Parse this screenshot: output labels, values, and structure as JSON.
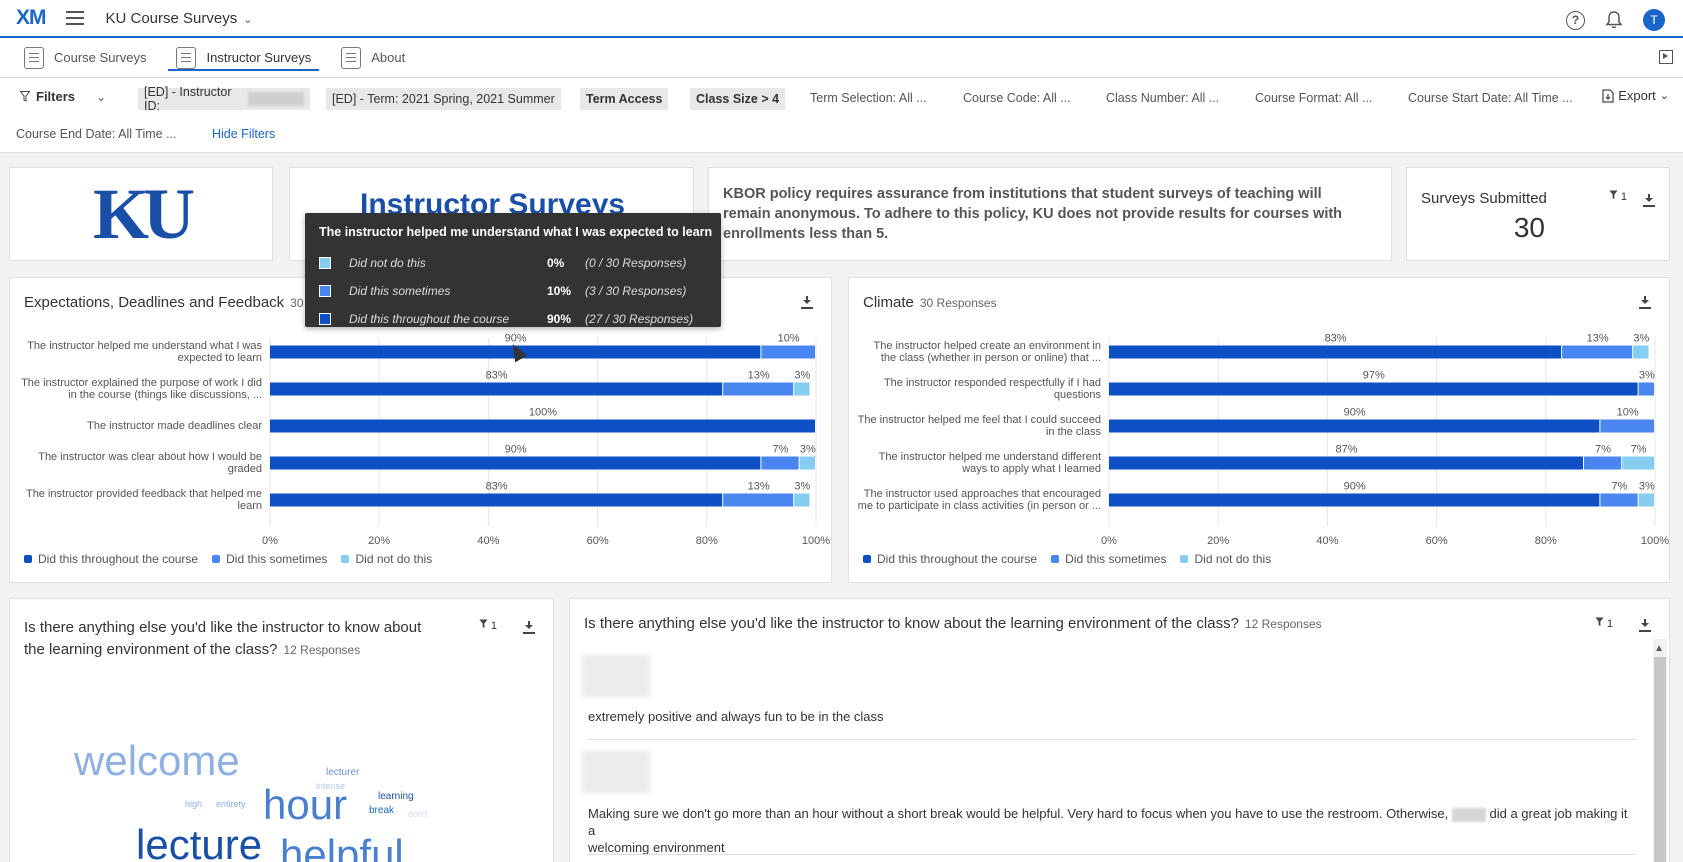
{
  "app": {
    "logo": "XM",
    "project_title": "KU Course Surveys",
    "help_label": "?",
    "avatar_initial": "T"
  },
  "tabs": [
    {
      "label": "Course Surveys"
    },
    {
      "label": "Instructor Surveys",
      "active": true
    },
    {
      "label": "About"
    }
  ],
  "filters": {
    "label": "Filters",
    "chips": {
      "instructor_id": "[ED] - Instructor ID:",
      "term": "[ED] - Term: 2021 Spring, 2021 Summer",
      "term_access": "Term Access",
      "class_size": "Class Size > 4"
    },
    "term_selection": "Term Selection:  All ...",
    "course_code": "Course Code:  All ...",
    "class_number": "Class Number:  All ...",
    "course_format": "Course Format:  All ...",
    "course_start": "Course Start Date: All Time ...",
    "course_end": "Course End Date: All Time ...",
    "hide_filters": "Hide Filters",
    "export": "Export"
  },
  "header_cards": {
    "logo_text": "KU",
    "instructor_title": "Instructor Surveys",
    "policy": "KBOR policy requires assurance from institutions that student surveys of teaching will remain anonymous. To adhere to this policy, KU does not provide results for courses with enrollments less than 5.",
    "surveys_submitted_label": "Surveys Submitted",
    "surveys_submitted_value": "30",
    "filter_count": "1"
  },
  "colors": {
    "throughout": "#0d4fc4",
    "sometimes": "#4a86f0",
    "not": "#85cef2"
  },
  "expectations": {
    "title": "Expectations, Deadlines and Feedback",
    "responses": "30 Responses",
    "legend": [
      "Did this throughout the course",
      "Did this sometimes",
      "Did not do this"
    ]
  },
  "climate": {
    "title": "Climate",
    "responses": "30 Responses",
    "legend": [
      "Did this throughout the course",
      "Did this sometimes",
      "Did not do this"
    ]
  },
  "chart_data": [
    {
      "type": "bar",
      "orientation": "horizontal-stacked",
      "title": "Expectations, Deadlines and Feedback",
      "categories": [
        "The instructor helped me understand what I was expected to learn",
        "The instructor explained the purpose of work I did in the course (things like discussions, ...",
        "The instructor made deadlines clear",
        "The instructor was clear about how I would be graded",
        "The instructor provided feedback that helped me learn"
      ],
      "category_lines": [
        [
          "The instructor helped me understand what I was",
          "expected to learn"
        ],
        [
          "The instructor explained the purpose of work I did",
          "in the course (things like discussions, ..."
        ],
        [
          "The instructor made deadlines clear"
        ],
        [
          "The instructor was clear about how I would be",
          "graded"
        ],
        [
          "The instructor provided feedback that helped me",
          "learn"
        ]
      ],
      "series": [
        {
          "name": "Did this throughout the course",
          "values": [
            90,
            83,
            100,
            90,
            83
          ]
        },
        {
          "name": "Did this sometimes",
          "values": [
            10,
            13,
            0,
            7,
            13
          ]
        },
        {
          "name": "Did not do this",
          "values": [
            0,
            3,
            0,
            3,
            3
          ]
        }
      ],
      "xlim": [
        0,
        100
      ],
      "x_ticks": [
        "0%",
        "20%",
        "40%",
        "60%",
        "80%",
        "100%"
      ],
      "legend_position": "bottom-left"
    },
    {
      "type": "bar",
      "orientation": "horizontal-stacked",
      "title": "Climate",
      "categories": [
        "The instructor helped create an environment in the class (whether in person or online) that ...",
        "The instructor responded respectfully if I had questions",
        "The instructor helped me feel that I could succeed in the class",
        "The instructor helped me understand different ways to apply what I learned",
        "The instructor used approaches that encouraged me to participate in class activities (in person or ..."
      ],
      "category_lines": [
        [
          "The instructor helped create an environment in",
          "the class (whether in person or online) that ..."
        ],
        [
          "The instructor responded respectfully if I had",
          "questions"
        ],
        [
          "The instructor helped me feel that I could succeed",
          "in the class"
        ],
        [
          "The instructor helped me understand different",
          "ways to apply what I learned"
        ],
        [
          "The instructor used approaches that encouraged",
          "me to participate in class activities (in person or ..."
        ]
      ],
      "series": [
        {
          "name": "Did this throughout the course",
          "values": [
            83,
            97,
            90,
            87,
            90
          ]
        },
        {
          "name": "Did this sometimes",
          "values": [
            13,
            3,
            10,
            7,
            7
          ]
        },
        {
          "name": "Did not do this",
          "values": [
            3,
            0,
            0,
            7,
            3
          ]
        }
      ],
      "xlim": [
        0,
        100
      ],
      "x_ticks": [
        "0%",
        "20%",
        "40%",
        "60%",
        "80%",
        "100%"
      ],
      "legend_position": "bottom-left"
    }
  ],
  "tooltip": {
    "title": "The instructor helped me understand what I was expected to learn",
    "rows": [
      {
        "label": "Did not do this",
        "pct": "0%",
        "resp": "(0 / 30 Responses)"
      },
      {
        "label": "Did this sometimes",
        "pct": "10%",
        "resp": "(3 / 30 Responses)"
      },
      {
        "label": "Did this throughout the course",
        "pct": "90%",
        "resp": "(27 / 30 Responses)"
      }
    ]
  },
  "wordcloud": {
    "title_line1": "Is there anything else you'd like the instructor to know about",
    "title_line2": "the learning environment of the class?",
    "responses": "12 Responses",
    "filter_count": "1",
    "words": {
      "welcome": "welcome",
      "lecturer": "lecturer",
      "intense": "intense",
      "learning": "learning",
      "high": "high",
      "entirety": "entirety",
      "hour": "hour",
      "break": "break",
      "dont": "don't",
      "lecture": "lecture",
      "helpful": "helpful"
    }
  },
  "comments": {
    "title": "Is there anything else you'd like the instructor to know about the learning environment of the class?",
    "responses": "12 Responses",
    "filter_count": "1",
    "items": [
      {
        "text": "extremely positive and always fun to be in the class"
      },
      {
        "text_a": "Making sure we don't go more than an hour without a short break would be helpful. Very hard to focus when you have to use the restroom. Otherwise,",
        "text_b": "did a great job making it a",
        "text_c": "welcoming environment"
      }
    ]
  }
}
